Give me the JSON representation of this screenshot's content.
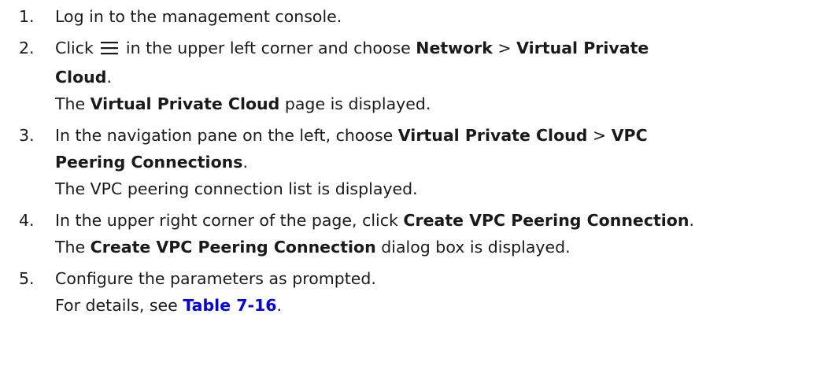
{
  "steps": [
    {
      "num": "1.",
      "text": "Log in to the management console."
    },
    {
      "num": "2.",
      "t1": "Click",
      "t2": "in the upper left corner and choose",
      "b1": "Network",
      "sep": ">",
      "b2": "Virtual Private",
      "b3": "Cloud",
      "end": ".",
      "icon": "menu-icon",
      "result": {
        "pre": "The",
        "bold": "Virtual Private Cloud",
        "post": "page is displayed."
      }
    },
    {
      "num": "3.",
      "t1": "In the navigation pane on the left, choose",
      "b1": "Virtual Private Cloud",
      "sep": ">",
      "b2": "VPC",
      "b3": "Peering Connections",
      "end": ".",
      "result": "The VPC peering connection list is displayed."
    },
    {
      "num": "4.",
      "t1": "In the upper right corner of the page, click",
      "b1": "Create VPC Peering Connection",
      "end": ".",
      "result": {
        "pre": "The",
        "bold": "Create VPC Peering Connection",
        "post": "dialog box is displayed."
      }
    },
    {
      "num": "5.",
      "text": "Configure the parameters as prompted.",
      "result": {
        "pre": "For details, see",
        "link": "Table 7-16",
        "post": "."
      }
    }
  ]
}
